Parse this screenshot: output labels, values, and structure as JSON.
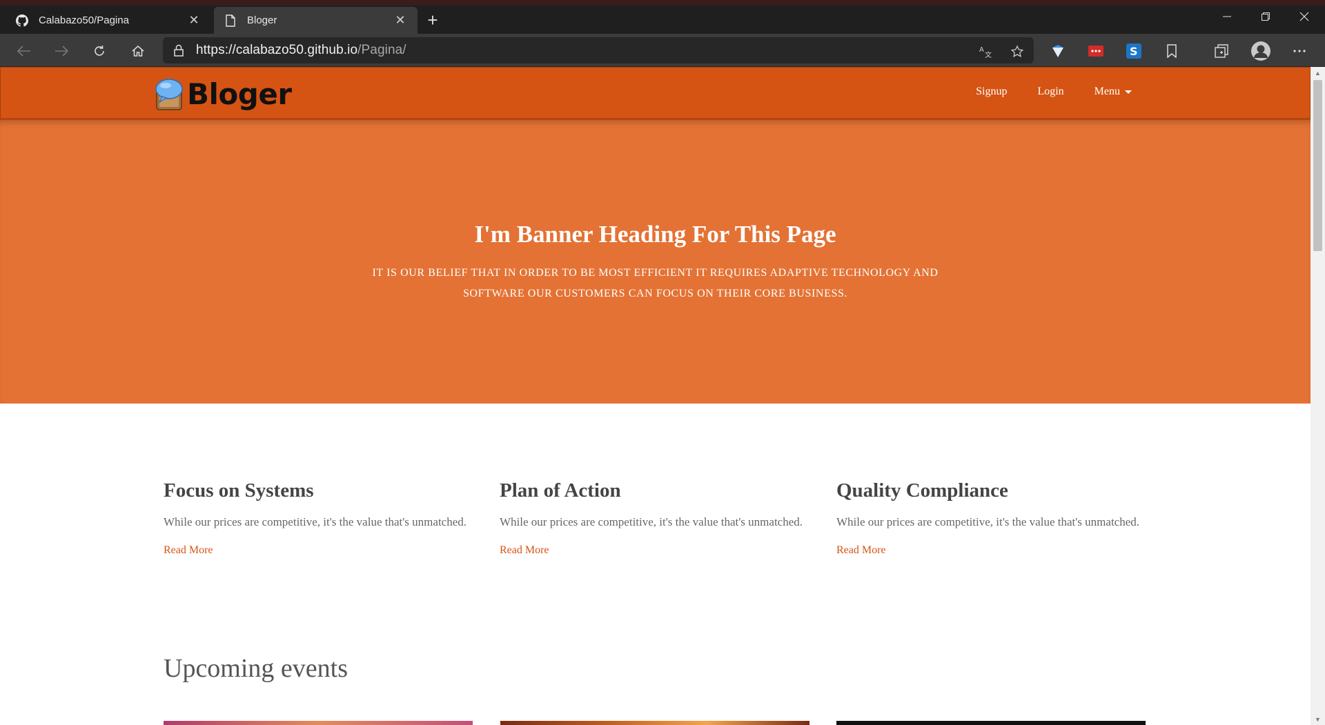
{
  "browser": {
    "tabs": [
      {
        "title": "Calabazo50/Pagina",
        "icon": "github-icon"
      },
      {
        "title": "Bloger",
        "icon": "page-icon"
      }
    ],
    "url": {
      "origin": "https://calabazo50.github.io",
      "path": "/Pagina/"
    }
  },
  "site": {
    "logo_text": "Bloger",
    "nav": {
      "signup": "Signup",
      "login": "Login",
      "menu": "Menu"
    },
    "accent_color": "#d55413",
    "banner_color": "#e47234"
  },
  "banner": {
    "heading": "I'm Banner Heading For This Page",
    "subheading": "IT IS OUR BELIEF THAT IN ORDER TO BE MOST EFFICIENT IT REQUIRES ADAPTIVE TECHNOLOGY AND SOFTWARE OUR CUSTOMERS CAN FOCUS ON THEIR CORE BUSINESS."
  },
  "features": [
    {
      "title": "Focus on Systems",
      "text": "While our prices are competitive, it's the value that's unmatched.",
      "link": "Read More"
    },
    {
      "title": "Plan of Action",
      "text": "While our prices are competitive, it's the value that's unmatched.",
      "link": "Read More"
    },
    {
      "title": "Quality Compliance",
      "text": "While our prices are competitive, it's the value that's unmatched.",
      "link": "Read More"
    }
  ],
  "events": {
    "title": "Upcoming events"
  }
}
